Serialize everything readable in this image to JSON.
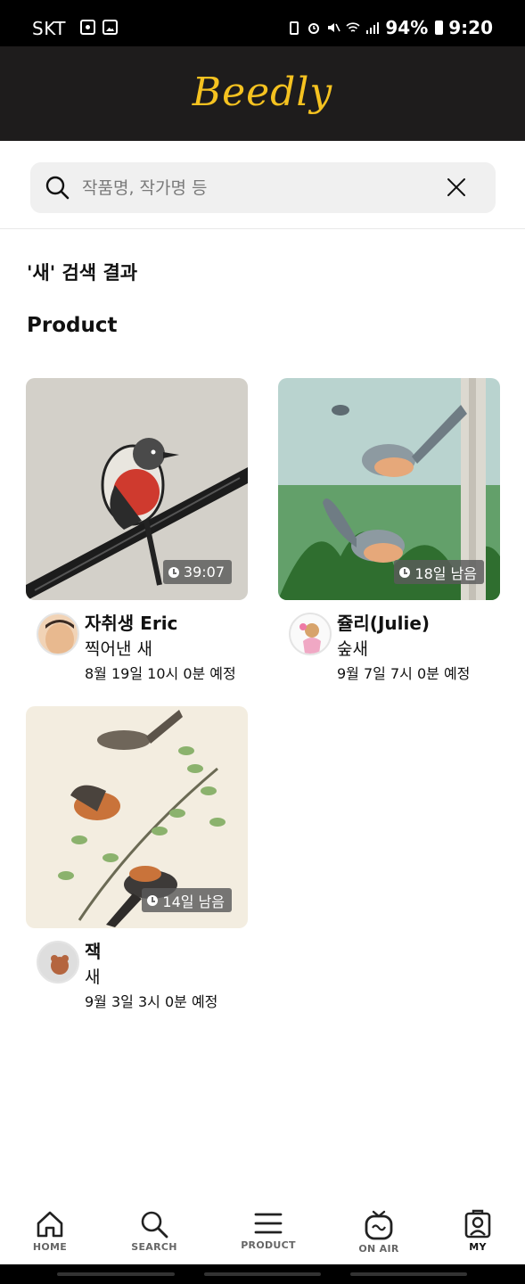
{
  "status_bar": {
    "carrier": "SKT",
    "battery": "94%",
    "time": "9:20"
  },
  "header": {
    "brand": "Beedly",
    "brand_color": "#f5c220"
  },
  "search": {
    "placeholder": "작품명, 작가명 등",
    "value": ""
  },
  "results": {
    "title": "'새' 검색 결과",
    "section": "Product",
    "items": [
      {
        "artist": "자취생 Eric",
        "title": "찍어낸 새",
        "schedule": "8월 19일 10시 0분 예정",
        "badge": "39:07"
      },
      {
        "artist": "쥴리(Julie)",
        "title": "숲새",
        "schedule": "9월 7일 7시 0분 예정",
        "badge": "18일 남음"
      },
      {
        "artist": "잭",
        "title": "새",
        "schedule": "9월 3일 3시 0분 예정",
        "badge": "14일 남음"
      }
    ]
  },
  "nav": {
    "items": [
      {
        "label": "HOME",
        "icon": "home-icon"
      },
      {
        "label": "SEARCH",
        "icon": "search-icon"
      },
      {
        "label": "PRODUCT",
        "icon": "menu-icon"
      },
      {
        "label": "ON AIR",
        "icon": "tv-icon"
      },
      {
        "label": "MY",
        "icon": "profile-icon"
      }
    ],
    "active": "MY"
  }
}
